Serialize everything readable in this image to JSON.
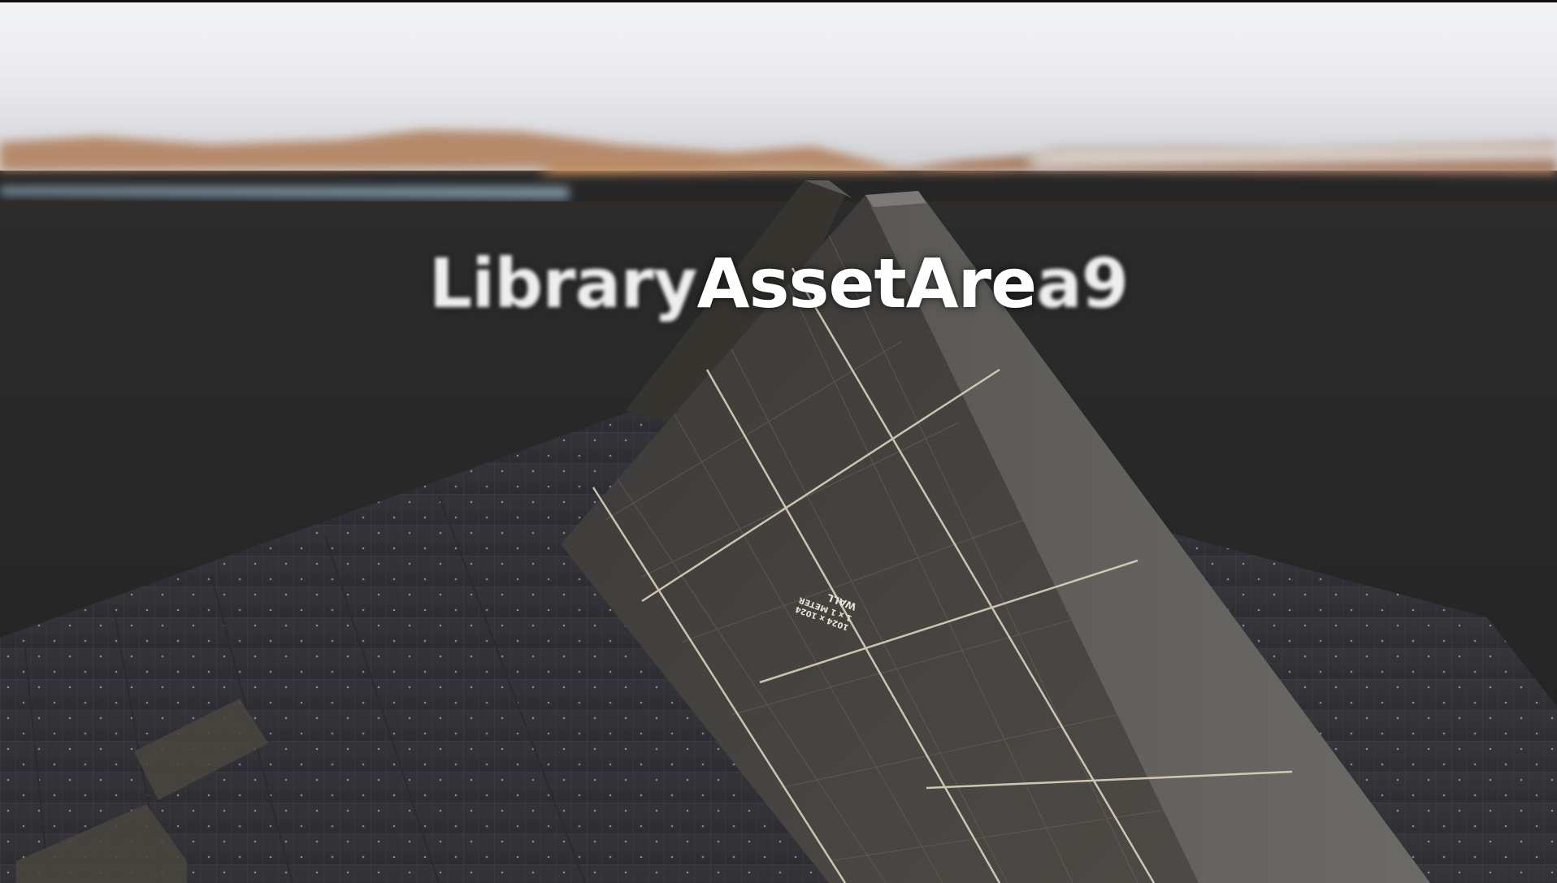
{
  "scene": {
    "area_label_prefix": "Library",
    "area_label_main": "AssetAre",
    "area_label_suffix": "a9",
    "sky_top_color": "#f4f5f7",
    "sky_horizon_color": "#d9dbe0",
    "mountain_color": "#a8785a",
    "void_color": "#262626",
    "floor_color": "#3b3b40",
    "wall_color": "#4a4744",
    "grid_line_color": "#d8cbb6"
  }
}
